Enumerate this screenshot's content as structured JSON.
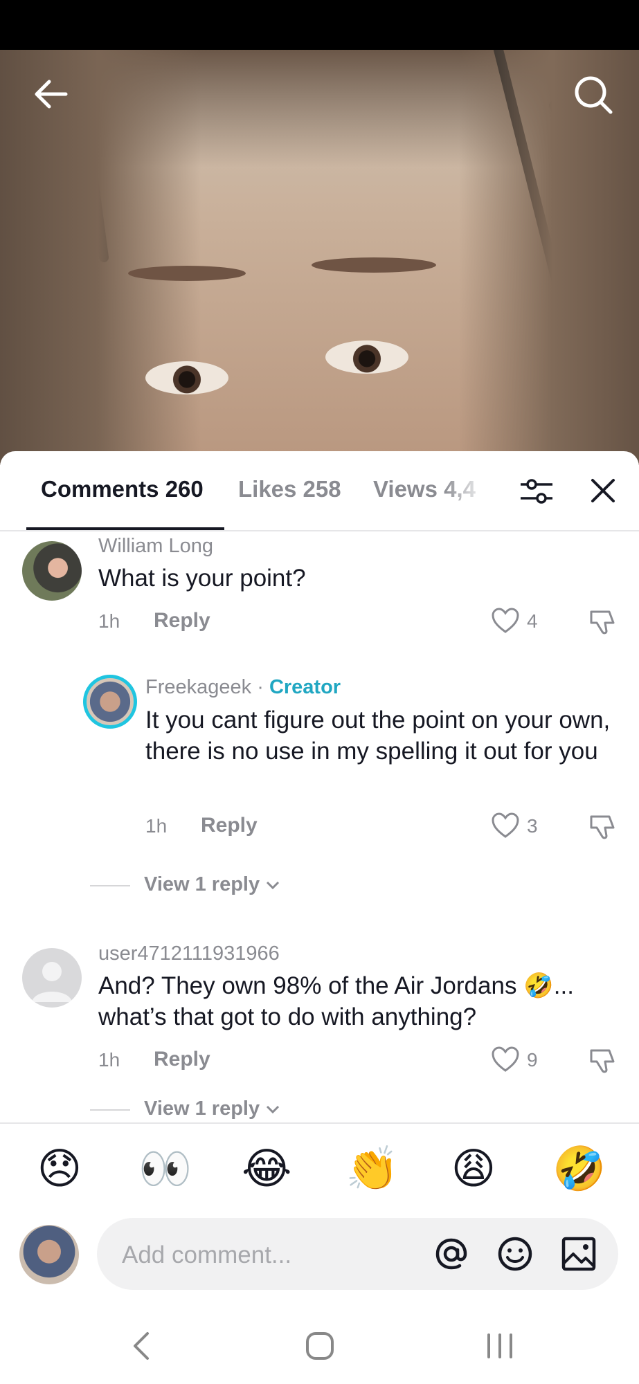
{
  "tabs": {
    "comments": "Comments 260",
    "likes": "Likes 258",
    "views": "Views 4,4"
  },
  "comments": [
    {
      "username": "William Long",
      "text": "What is your point?",
      "time": "1h",
      "reply_label": "Reply",
      "likes": "4"
    },
    {
      "username": "Freekageek",
      "badge_separator": " · ",
      "badge": "Creator",
      "text": "It you cant figure out the point on your own, there is no use in my spelling it out for you",
      "time": "1h",
      "reply_label": "Reply",
      "likes": "3"
    },
    {
      "username": "user4712111931966",
      "text": "And? They own 98% of the Air Jordans 🤣... what’s that got to do with anything?",
      "time": "1h",
      "reply_label": "Reply",
      "likes": "9"
    }
  ],
  "view_replies": [
    {
      "label": "View 1 reply"
    },
    {
      "label": "View 1 reply"
    }
  ],
  "quick_emojis": [
    "😞",
    "👀",
    "😂",
    "👏",
    "😩",
    "🤣"
  ],
  "input": {
    "placeholder": "Add comment..."
  },
  "colors": {
    "creator": "#20a7c2",
    "secondary_text": "#8a8b91",
    "primary_text": "#161823",
    "input_bg": "#f1f1f2"
  }
}
